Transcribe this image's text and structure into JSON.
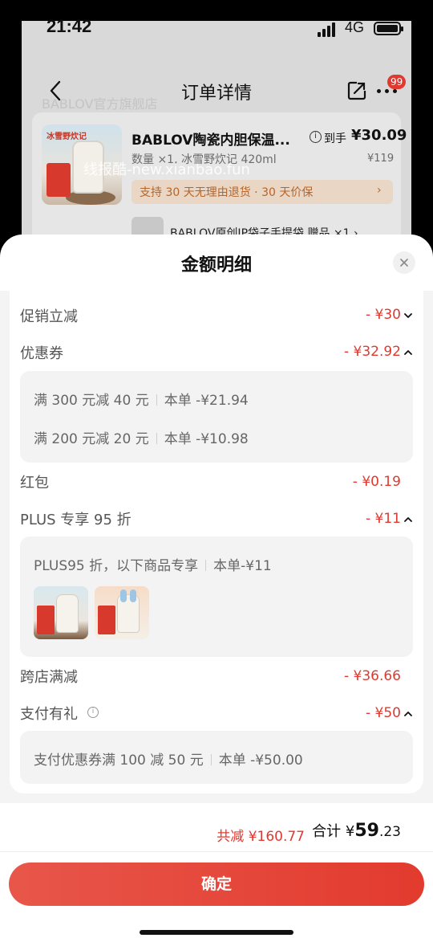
{
  "status_bar": {
    "time": "21:42",
    "network": "4G"
  },
  "background_page": {
    "title": "订单详情",
    "badge_count": "99",
    "store_name": "BABLOV官方旗舰店",
    "product": {
      "image_tag": "冰雪野炊记",
      "title": "BABLOV陶瓷内胆保温...",
      "price_label": "到手",
      "price": "¥30.09",
      "spec": "数量 ×1, 冰雪野炊记 420ml",
      "original_price": "¥119",
      "promo": "支持 30 天无理由退货 · 30 天价保",
      "promo_arrow": "›"
    },
    "gift": "BABLOV原创IP袋子手提袋   赠品 ×1 ›",
    "watermark": "线报酷-new.xianbao.fun"
  },
  "sheet": {
    "title": "金额明细",
    "rows": {
      "promo_discount": {
        "label": "促销立减",
        "value": "- ¥30"
      },
      "coupon": {
        "label": "优惠券",
        "value": "- ¥32.92"
      },
      "red_packet": {
        "label": "红包",
        "value": "- ¥0.19"
      },
      "plus": {
        "label": "PLUS 专享 95 折",
        "value": "- ¥11"
      },
      "cross_store": {
        "label": "跨店满减",
        "value": "- ¥36.66"
      },
      "payment_gift": {
        "label": "支付有礼",
        "value": "- ¥50"
      }
    },
    "coupon_details": [
      {
        "title": "满 300 元减 40 元",
        "amount": "本单 -¥21.94"
      },
      {
        "title": "满 200 元减 20 元",
        "amount": "本单 -¥10.98"
      }
    ],
    "plus_detail": {
      "title": "PLUS95 折，以下商品专享",
      "amount": "本单-¥11"
    },
    "payment_detail": {
      "title": "支付优惠券满 100 减 50 元",
      "amount": "本单 -¥50.00"
    },
    "icons": [
      "close-icon",
      "chevron-down-icon",
      "chevron-up-icon",
      "info-icon"
    ]
  },
  "footer": {
    "total_discount": "共减 ¥160.77",
    "total_label": "合计",
    "total_currency": "¥",
    "total_integer": "59",
    "total_decimal": ".23",
    "confirm_label": "确定"
  },
  "colors": {
    "accent": "#e0392f",
    "sheet_bg": "#ffffff",
    "list_bg": "#f4f4f4"
  }
}
